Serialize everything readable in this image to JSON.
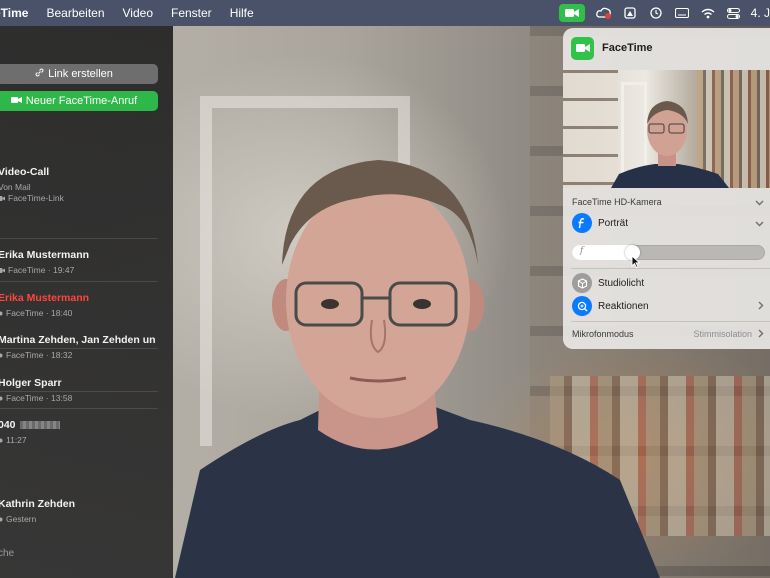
{
  "menubar": {
    "app_name": "eTime",
    "items": [
      "Bearbeiten",
      "Video",
      "Fenster",
      "Hilfe"
    ],
    "clock": "4. J"
  },
  "sidebar": {
    "link_button": "Link erstellen",
    "new_call_button": "Neuer FaceTime-Anruf",
    "section_label": "t",
    "bottom_label": "che",
    "calls": [
      {
        "name": "Video-Call",
        "line1": "Von Mail",
        "line2": "FaceTime-Link",
        "missed": false
      },
      {
        "name": "Erika Mustermann",
        "line1": "FaceTime · 19:47",
        "missed": false
      },
      {
        "name": "Erika Mustermann",
        "line1": "FaceTime · 18:40",
        "missed": true
      },
      {
        "name": "Martina Zehden, Jan Zehden und…",
        "line1": "FaceTime · 18:32",
        "missed": false
      },
      {
        "name": "Holger Sparr",
        "line1": "FaceTime · 13:58",
        "missed": false
      },
      {
        "name": "040",
        "line1": "11:27",
        "missed": false
      },
      {
        "name": "Kathrin Zehden",
        "line1": "Gestern",
        "missed": false
      }
    ]
  },
  "popover": {
    "title": "FaceTime",
    "camera_label": "FaceTime HD-Kamera",
    "portrait_label": "Porträt",
    "portrait_depth_level": 0.3,
    "slider_glyph": "f",
    "studio_light_label": "Studiolicht",
    "reactions_label": "Reaktionen",
    "mic_mode_label": "Mikrofonmodus",
    "mic_mode_value": "Stimmisolation"
  },
  "colors": {
    "accent_green": "#2fb84a",
    "accent_blue": "#0a7aff",
    "missed_red": "#ff453a"
  }
}
